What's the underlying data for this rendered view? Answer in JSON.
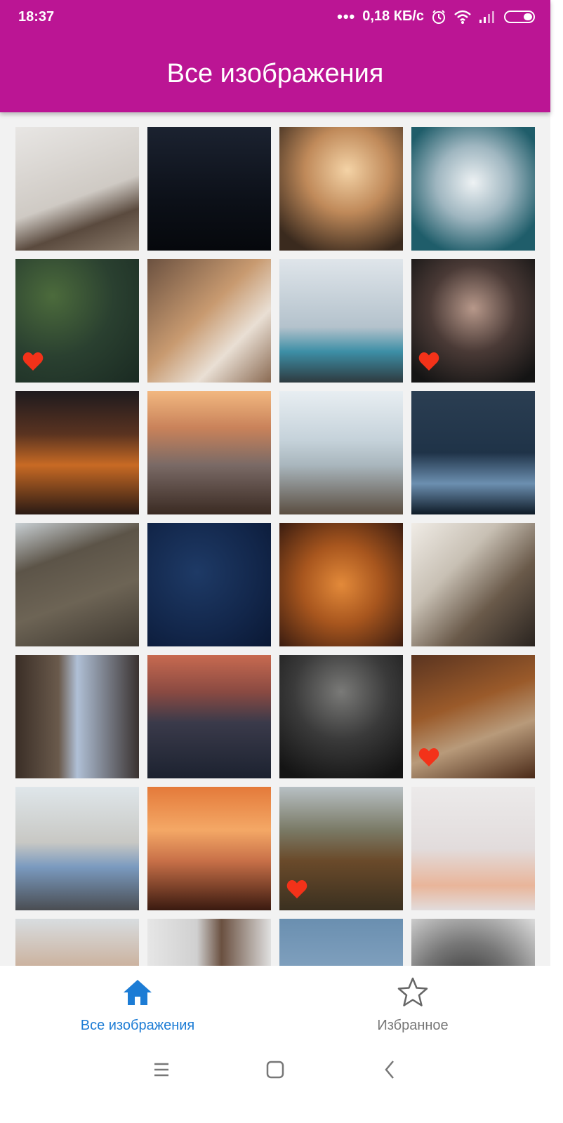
{
  "status_bar": {
    "time": "18:37",
    "dots": "•••",
    "speed": "0,18 КБ/с",
    "icons": [
      "alarm-icon",
      "wifi-icon",
      "signal-icon",
      "battery-icon"
    ]
  },
  "app_bar": {
    "title": "Все изображения",
    "color": "#bb1594"
  },
  "gallery": {
    "tiles": [
      {
        "name": "women-laptop-office",
        "favorite": false
      },
      {
        "name": "night-sky-trees",
        "favorite": false
      },
      {
        "name": "sunset-silhouette-plants",
        "favorite": false
      },
      {
        "name": "polar-bear-underwater",
        "favorite": false
      },
      {
        "name": "aerial-forest",
        "favorite": true
      },
      {
        "name": "couple-tablet-living-room",
        "favorite": false
      },
      {
        "name": "woman-with-flowers",
        "favorite": false
      },
      {
        "name": "woman-portrait-dark",
        "favorite": true
      },
      {
        "name": "sunset-clouds",
        "favorite": false
      },
      {
        "name": "beach-rocks-sunset",
        "favorite": false
      },
      {
        "name": "cafe-windows-sea",
        "favorite": false
      },
      {
        "name": "city-skyline-night",
        "favorite": false
      },
      {
        "name": "mountain-valley-river",
        "favorite": false
      },
      {
        "name": "starry-night-sky",
        "favorite": false
      },
      {
        "name": "autumn-forest-aerial",
        "favorite": false
      },
      {
        "name": "laptop-meeting-table",
        "favorite": false
      },
      {
        "name": "cave-waterfall",
        "favorite": false
      },
      {
        "name": "city-bridge-dusk",
        "favorite": false
      },
      {
        "name": "white-car-garage",
        "favorite": false
      },
      {
        "name": "autumn-path",
        "favorite": true
      },
      {
        "name": "laptop-on-table",
        "favorite": false
      },
      {
        "name": "horse-rider-sunset",
        "favorite": false
      },
      {
        "name": "foggy-forest-road",
        "favorite": true
      },
      {
        "name": "stacked-cups",
        "favorite": false
      },
      {
        "name": "woman-pool",
        "favorite": false
      },
      {
        "name": "woman-portrait-light",
        "favorite": false
      },
      {
        "name": "moon-blue-sky",
        "favorite": false
      },
      {
        "name": "gas-mask-portrait",
        "favorite": false
      }
    ],
    "heart_color": "#f33219"
  },
  "bottom_nav": {
    "items": [
      {
        "label": "Все изображения",
        "icon": "home-icon",
        "active": true
      },
      {
        "label": "Избранное",
        "icon": "star-icon",
        "active": false
      }
    ],
    "active_color": "#1c7cd5"
  },
  "system_nav": {
    "icons": [
      "menu-icon",
      "home-square-icon",
      "back-icon"
    ]
  }
}
